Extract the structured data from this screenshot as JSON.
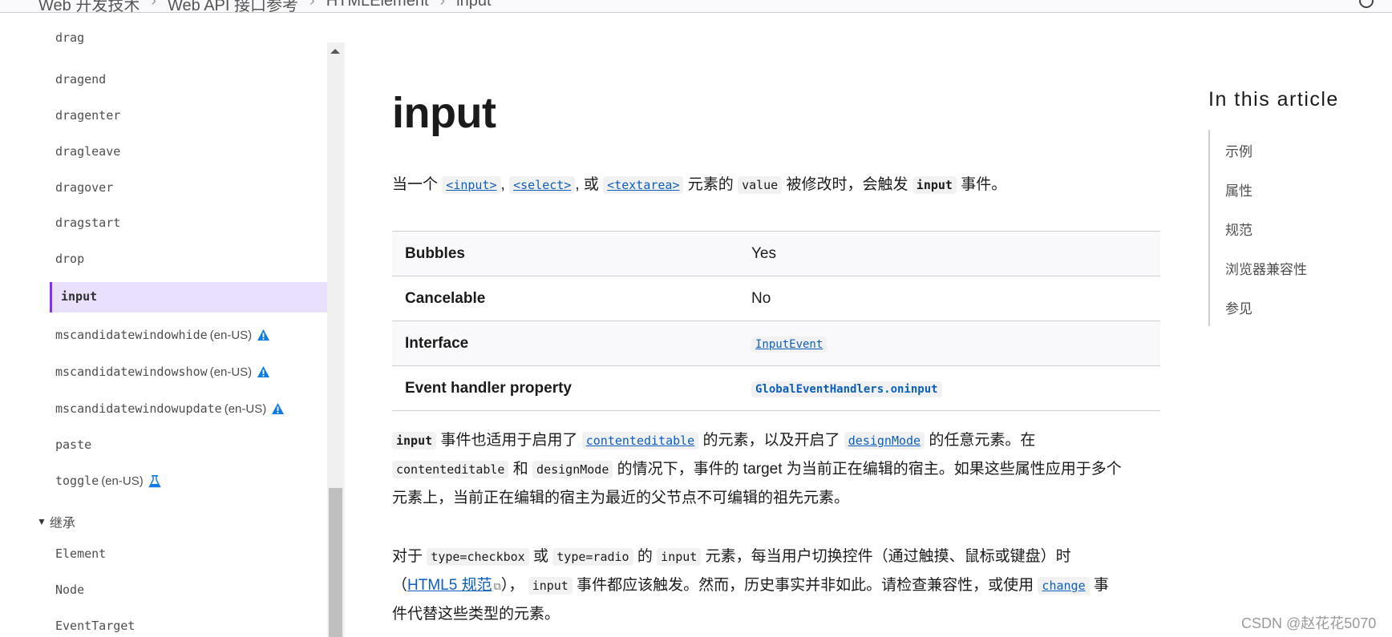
{
  "breadcrumb": [
    "Web 开发技术",
    "Web API 接口参考",
    "HTMLElement",
    "input"
  ],
  "sidebar": {
    "items": [
      {
        "label": "drag"
      },
      {
        "label": "dragend"
      },
      {
        "label": "dragenter"
      },
      {
        "label": "dragleave"
      },
      {
        "label": "dragover"
      },
      {
        "label": "dragstart"
      },
      {
        "label": "drop"
      },
      {
        "label": "input",
        "active": true
      },
      {
        "label": "mscandidatewindowhide",
        "lang": "(en-US)",
        "badge": "warning-icon"
      },
      {
        "label": "mscandidatewindowshow",
        "lang": "(en-US)",
        "badge": "warning-icon"
      },
      {
        "label": "mscandidatewindowupdate",
        "lang": "(en-US)",
        "badge": "warning-icon"
      },
      {
        "label": "paste"
      },
      {
        "label": "toggle",
        "lang": "(en-US)",
        "badge": "experimental-flask-icon"
      }
    ],
    "group": {
      "label": "继承",
      "expanded": true
    },
    "inherit_items": [
      {
        "label": "Element"
      },
      {
        "label": "Node"
      },
      {
        "label": "EventTarget"
      }
    ],
    "scroll_position_percent": 82
  },
  "main": {
    "title": "input",
    "intro": {
      "t1": "当一个",
      "link_input": "<input>",
      "comma1": ",",
      "link_select": "<select>",
      "t2": ", 或",
      "link_textarea": "<textarea>",
      "t3": "元素的",
      "code_value": "value",
      "t4": "被修改时，会触发",
      "code_input": "input",
      "t5": "事件。"
    },
    "table": [
      {
        "key": "Bubbles",
        "value": "Yes"
      },
      {
        "key": "Cancelable",
        "value": "No"
      },
      {
        "key": "Interface",
        "value": "InputEvent",
        "value_type": "link"
      },
      {
        "key": "Event handler property",
        "value": "GlobalEventHandlers.oninput",
        "value_type": "link-bold"
      }
    ],
    "para1": {
      "code_input": "input",
      "t1": "事件也适用于启用了",
      "link_contenteditable": "contenteditable",
      "t2": "的元素，以及开启了",
      "link_designmode": "designMode",
      "t3": "的任意元素。在",
      "code_contenteditable": "contenteditable",
      "t4": "和",
      "code_designmode": "designMode",
      "t5": "的情况下，事件的 target 为当前正在编辑的宿主。如果这些属性应用于多个",
      "t6": "元素上，当前正在编辑的宿主为最近的父节点不可编辑的祖先元素。"
    },
    "para2": {
      "t1": "对于",
      "code_checkbox": "type=checkbox",
      "t2": "或",
      "code_radio": "type=radio",
      "t3": "的",
      "code_input": "input",
      "t4": "元素，每当用户切换控件（通过触摸、鼠标或键盘）时",
      "t5": "（",
      "link_spec": "HTML5 规范",
      "t6": "），",
      "code_input2": "input",
      "t7": "事件都应该触发。然而，历史事实并非如此。请检查兼容性，或使用",
      "link_change": "change",
      "t8": "事",
      "t9": "件代替这些类型的元素。"
    }
  },
  "toc": {
    "title": "In this article",
    "items": [
      "示例",
      "属性",
      "规范",
      "浏览器兼容性",
      "参见"
    ]
  },
  "watermark": "CSDN @赵花花5070",
  "colors": {
    "link": "#0b5fbf",
    "active_bg": "#e9e0fd",
    "active_border": "#8334e8",
    "warning": "#0e7ce8"
  }
}
